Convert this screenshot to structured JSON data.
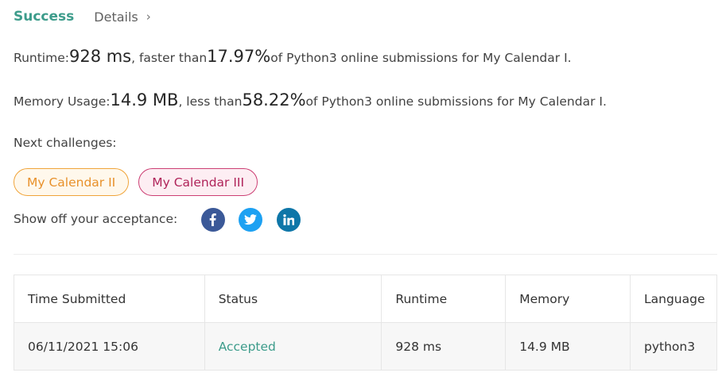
{
  "header": {
    "title": "Success",
    "details_label": "Details",
    "details_chevron": "›"
  },
  "runtime": {
    "label": "Runtime: ",
    "value": "928 ms",
    "mid": ", faster than ",
    "percent": "17.97%",
    "suffix": " of Python3 online submissions for My Calendar I."
  },
  "memory": {
    "label": "Memory Usage: ",
    "value": "14.9 MB",
    "mid": ", less than ",
    "percent": "58.22%",
    "suffix": " of Python3 online submissions for My Calendar I."
  },
  "next": {
    "label": "Next challenges:",
    "items": [
      {
        "label": "My Calendar II",
        "difficulty_color": "#f0a43a"
      },
      {
        "label": "My Calendar III",
        "difficulty_color": "#cc3e73"
      }
    ]
  },
  "share": {
    "label": "Show off your acceptance:",
    "icons": [
      "facebook-icon",
      "twitter-icon",
      "linkedin-icon"
    ]
  },
  "table": {
    "headers": [
      "Time Submitted",
      "Status",
      "Runtime",
      "Memory",
      "Language"
    ],
    "rows": [
      {
        "time": "06/11/2021 15:06",
        "status": "Accepted",
        "runtime": "928 ms",
        "memory": "14.9 MB",
        "language": "python3"
      }
    ]
  },
  "colors": {
    "accent": "#3d9c8b",
    "medium": "#f0a43a",
    "hard": "#cc3e73"
  }
}
